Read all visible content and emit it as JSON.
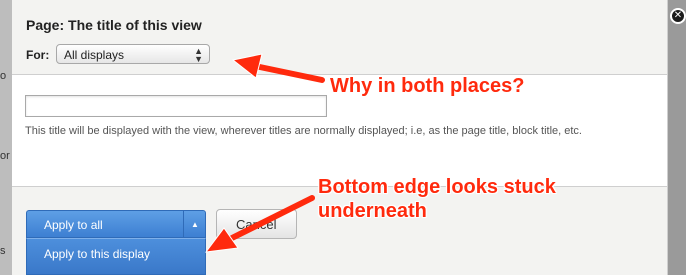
{
  "dialog": {
    "title": "Page: The title of this view",
    "for_label": "For:",
    "for_select_value": "All displays",
    "title_input_value": "",
    "description": "This title will be displayed with the view, wherever titles are normally displayed; i.e, as the page title, block title, etc."
  },
  "buttons": {
    "apply_all": "Apply to all",
    "apply_this_display": "Apply to this display",
    "cancel": "Cancel"
  },
  "background": {
    "left_letters": [
      "o",
      "or",
      "s"
    ]
  },
  "annotations": {
    "note_1": "Why in both places?",
    "note_2": "Bottom edge looks stuck underneath",
    "color": "#ff2a0d"
  },
  "icons": {
    "close": "close-icon",
    "select_arrows": "updown-arrows-icon",
    "dropdown_toggle": "caret-up-icon"
  }
}
